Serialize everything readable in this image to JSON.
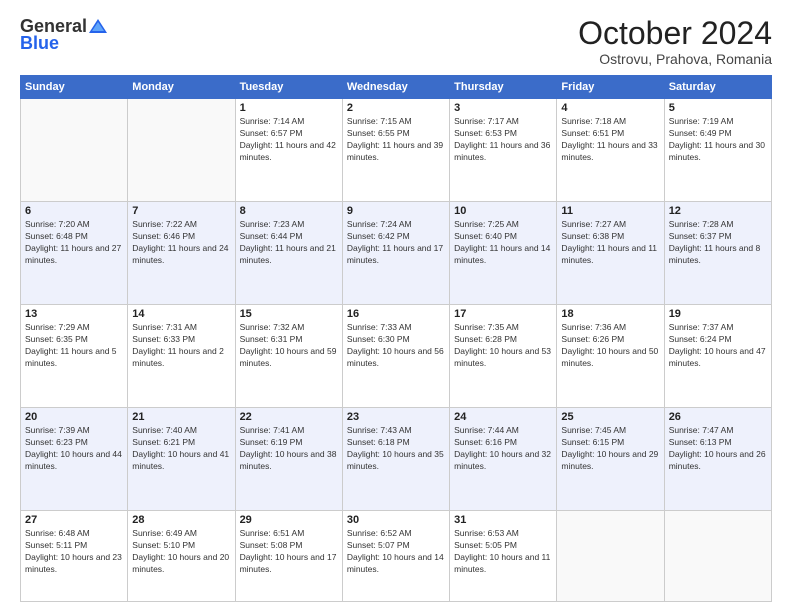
{
  "header": {
    "logo_general": "General",
    "logo_blue": "Blue",
    "month": "October 2024",
    "location": "Ostrovu, Prahova, Romania"
  },
  "days_of_week": [
    "Sunday",
    "Monday",
    "Tuesday",
    "Wednesday",
    "Thursday",
    "Friday",
    "Saturday"
  ],
  "weeks": [
    [
      {
        "day": "",
        "info": ""
      },
      {
        "day": "",
        "info": ""
      },
      {
        "day": "1",
        "info": "Sunrise: 7:14 AM\nSunset: 6:57 PM\nDaylight: 11 hours and 42 minutes."
      },
      {
        "day": "2",
        "info": "Sunrise: 7:15 AM\nSunset: 6:55 PM\nDaylight: 11 hours and 39 minutes."
      },
      {
        "day": "3",
        "info": "Sunrise: 7:17 AM\nSunset: 6:53 PM\nDaylight: 11 hours and 36 minutes."
      },
      {
        "day": "4",
        "info": "Sunrise: 7:18 AM\nSunset: 6:51 PM\nDaylight: 11 hours and 33 minutes."
      },
      {
        "day": "5",
        "info": "Sunrise: 7:19 AM\nSunset: 6:49 PM\nDaylight: 11 hours and 30 minutes."
      }
    ],
    [
      {
        "day": "6",
        "info": "Sunrise: 7:20 AM\nSunset: 6:48 PM\nDaylight: 11 hours and 27 minutes."
      },
      {
        "day": "7",
        "info": "Sunrise: 7:22 AM\nSunset: 6:46 PM\nDaylight: 11 hours and 24 minutes."
      },
      {
        "day": "8",
        "info": "Sunrise: 7:23 AM\nSunset: 6:44 PM\nDaylight: 11 hours and 21 minutes."
      },
      {
        "day": "9",
        "info": "Sunrise: 7:24 AM\nSunset: 6:42 PM\nDaylight: 11 hours and 17 minutes."
      },
      {
        "day": "10",
        "info": "Sunrise: 7:25 AM\nSunset: 6:40 PM\nDaylight: 11 hours and 14 minutes."
      },
      {
        "day": "11",
        "info": "Sunrise: 7:27 AM\nSunset: 6:38 PM\nDaylight: 11 hours and 11 minutes."
      },
      {
        "day": "12",
        "info": "Sunrise: 7:28 AM\nSunset: 6:37 PM\nDaylight: 11 hours and 8 minutes."
      }
    ],
    [
      {
        "day": "13",
        "info": "Sunrise: 7:29 AM\nSunset: 6:35 PM\nDaylight: 11 hours and 5 minutes."
      },
      {
        "day": "14",
        "info": "Sunrise: 7:31 AM\nSunset: 6:33 PM\nDaylight: 11 hours and 2 minutes."
      },
      {
        "day": "15",
        "info": "Sunrise: 7:32 AM\nSunset: 6:31 PM\nDaylight: 10 hours and 59 minutes."
      },
      {
        "day": "16",
        "info": "Sunrise: 7:33 AM\nSunset: 6:30 PM\nDaylight: 10 hours and 56 minutes."
      },
      {
        "day": "17",
        "info": "Sunrise: 7:35 AM\nSunset: 6:28 PM\nDaylight: 10 hours and 53 minutes."
      },
      {
        "day": "18",
        "info": "Sunrise: 7:36 AM\nSunset: 6:26 PM\nDaylight: 10 hours and 50 minutes."
      },
      {
        "day": "19",
        "info": "Sunrise: 7:37 AM\nSunset: 6:24 PM\nDaylight: 10 hours and 47 minutes."
      }
    ],
    [
      {
        "day": "20",
        "info": "Sunrise: 7:39 AM\nSunset: 6:23 PM\nDaylight: 10 hours and 44 minutes."
      },
      {
        "day": "21",
        "info": "Sunrise: 7:40 AM\nSunset: 6:21 PM\nDaylight: 10 hours and 41 minutes."
      },
      {
        "day": "22",
        "info": "Sunrise: 7:41 AM\nSunset: 6:19 PM\nDaylight: 10 hours and 38 minutes."
      },
      {
        "day": "23",
        "info": "Sunrise: 7:43 AM\nSunset: 6:18 PM\nDaylight: 10 hours and 35 minutes."
      },
      {
        "day": "24",
        "info": "Sunrise: 7:44 AM\nSunset: 6:16 PM\nDaylight: 10 hours and 32 minutes."
      },
      {
        "day": "25",
        "info": "Sunrise: 7:45 AM\nSunset: 6:15 PM\nDaylight: 10 hours and 29 minutes."
      },
      {
        "day": "26",
        "info": "Sunrise: 7:47 AM\nSunset: 6:13 PM\nDaylight: 10 hours and 26 minutes."
      }
    ],
    [
      {
        "day": "27",
        "info": "Sunrise: 6:48 AM\nSunset: 5:11 PM\nDaylight: 10 hours and 23 minutes."
      },
      {
        "day": "28",
        "info": "Sunrise: 6:49 AM\nSunset: 5:10 PM\nDaylight: 10 hours and 20 minutes."
      },
      {
        "day": "29",
        "info": "Sunrise: 6:51 AM\nSunset: 5:08 PM\nDaylight: 10 hours and 17 minutes."
      },
      {
        "day": "30",
        "info": "Sunrise: 6:52 AM\nSunset: 5:07 PM\nDaylight: 10 hours and 14 minutes."
      },
      {
        "day": "31",
        "info": "Sunrise: 6:53 AM\nSunset: 5:05 PM\nDaylight: 10 hours and 11 minutes."
      },
      {
        "day": "",
        "info": ""
      },
      {
        "day": "",
        "info": ""
      }
    ]
  ]
}
